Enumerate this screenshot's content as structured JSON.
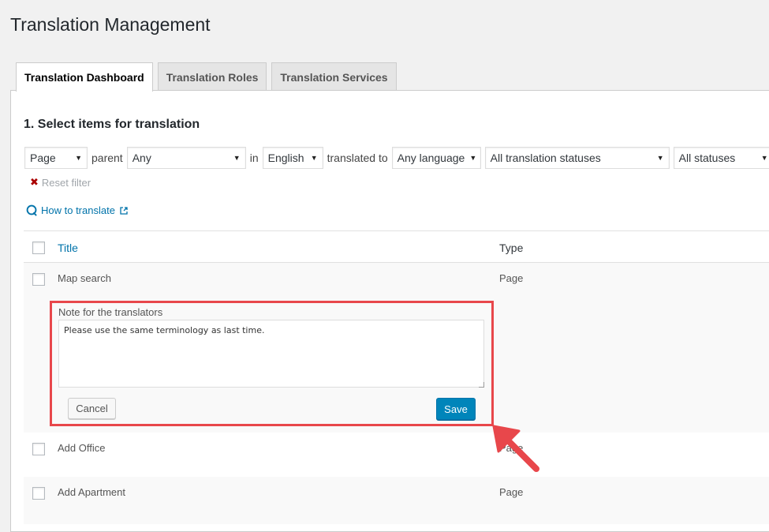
{
  "page_title": "Translation Management",
  "tabs": [
    {
      "label": "Translation Dashboard",
      "active": true
    },
    {
      "label": "Translation Roles",
      "active": false
    },
    {
      "label": "Translation Services",
      "active": false
    }
  ],
  "section_title": "1. Select items for translation",
  "filters": {
    "type_select": "Page",
    "parent_label": "parent",
    "parent_select": "Any",
    "in_label": "in",
    "language_select": "English",
    "translated_to_label": "translated to",
    "target_language_select": "Any language",
    "translation_status_select": "All translation statuses",
    "status_select": "All statuses"
  },
  "reset_filter_label": "Reset filter",
  "how_to_translate_label": "How to translate",
  "table": {
    "columns": {
      "title": "Title",
      "type": "Type"
    },
    "rows": [
      {
        "title": "Map search",
        "type": "Page"
      },
      {
        "title": "Add Office",
        "type": "Page"
      },
      {
        "title": "Add Apartment",
        "type": "Page"
      }
    ]
  },
  "note": {
    "label": "Note for the translators",
    "value": "Please use the same terminology as last time.",
    "cancel_label": "Cancel",
    "save_label": "Save"
  },
  "colors": {
    "highlight": "#e8474b",
    "link": "#0073aa",
    "primary_button": "#0085ba"
  },
  "icons": [
    "close-icon",
    "help-icon",
    "external-link-icon",
    "chevron-down-icon",
    "arrow-pointer-icon"
  ]
}
